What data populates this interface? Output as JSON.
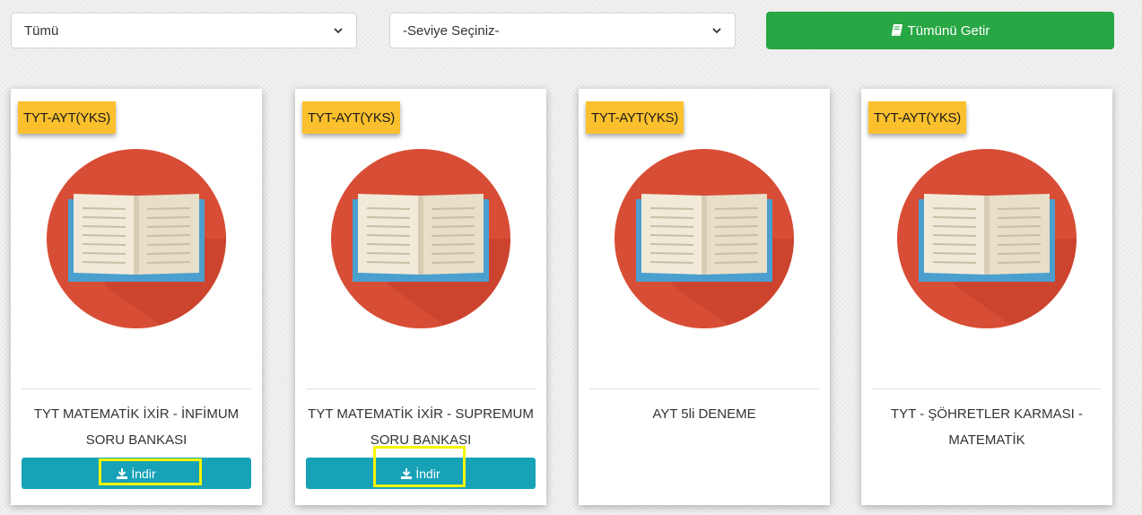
{
  "filters": {
    "category_value": "Tümü",
    "level_value": "-Seviye Seçiniz-",
    "fetch_all_label": "Tümünü Getir"
  },
  "cards": [
    {
      "tag": "TYT-AYT(YKS)",
      "title": "TYT MATEMATİK İXİR - İNFİMUM SORU BANKASI",
      "download_label": "İndir"
    },
    {
      "tag": "TYT-AYT(YKS)",
      "title": "TYT MATEMATİK İXİR - SUPREMUM SORU BANKASI",
      "download_label": "İndir"
    },
    {
      "tag": "TYT-AYT(YKS)",
      "title": "AYT 5li DENEME"
    },
    {
      "tag": "TYT-AYT(YKS)",
      "title": "TYT - ŞÖHRETLER KARMASI - MATEMATİK"
    }
  ],
  "icons": {
    "select_caret": "chevron-down-icon",
    "fetch_all": "book-icon",
    "card_cover": "open-book-icon",
    "download": "download-icon"
  },
  "colors": {
    "success_button": "#28a745",
    "download_button": "#17a2b8",
    "tag_background": "#fbc02d",
    "cover_circle": "#d84d35",
    "highlight_box": "#f5f500"
  }
}
